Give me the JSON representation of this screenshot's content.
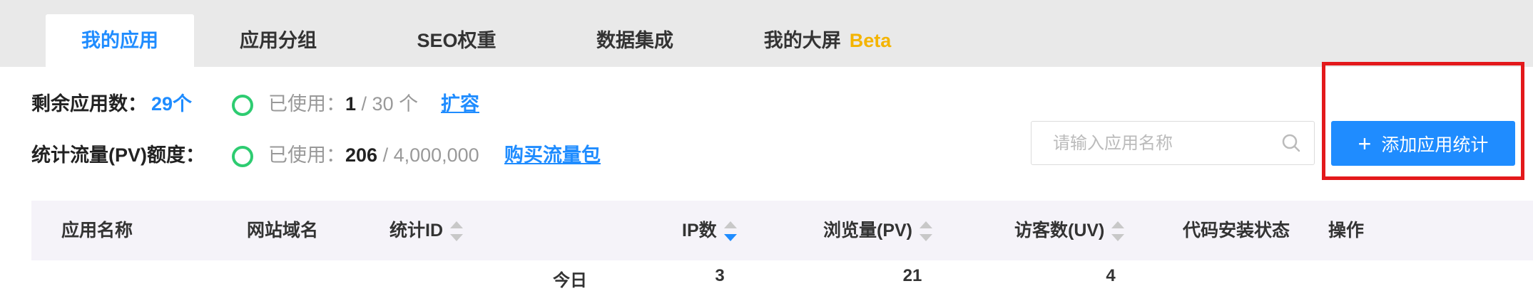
{
  "tabs": [
    {
      "label": "我的应用",
      "active": true
    },
    {
      "label": "应用分组"
    },
    {
      "label": "SEO权重"
    },
    {
      "label": "数据集成"
    },
    {
      "label": "我的大屏",
      "badge": "Beta"
    }
  ],
  "quota": {
    "apps": {
      "label": "剩余应用数：",
      "value": "29个",
      "used_label": "已使用：",
      "used": "1",
      "total": "/ 30 个",
      "action": "扩容"
    },
    "traffic": {
      "label": "统计流量(PV)额度：",
      "used_label": "已使用：",
      "used": "206",
      "total": "/ 4,000,000",
      "action": "购买流量包"
    }
  },
  "search": {
    "placeholder": "请输入应用名称",
    "icon": "search-icon"
  },
  "add_button": {
    "icon": "plus-icon",
    "label": "添加应用统计"
  },
  "table": {
    "columns": [
      {
        "label": "应用名称"
      },
      {
        "label": "网站域名"
      },
      {
        "label": "统计ID",
        "sortable": true
      },
      {
        "label": "IP数",
        "sortable": true,
        "sorted": "desc"
      },
      {
        "label": "浏览量(PV)",
        "sortable": true
      },
      {
        "label": "访客数(UV)",
        "sortable": true
      },
      {
        "label": "代码安装状态"
      },
      {
        "label": "操作"
      }
    ],
    "rows": [
      {
        "period": "今日",
        "ip": "3",
        "pv": "21",
        "uv": "4"
      }
    ]
  },
  "colors": {
    "accent": "#1f8cff",
    "used_indicator": "#2ecc71",
    "beta": "#f4b400",
    "highlight_box": "#e3191b"
  }
}
